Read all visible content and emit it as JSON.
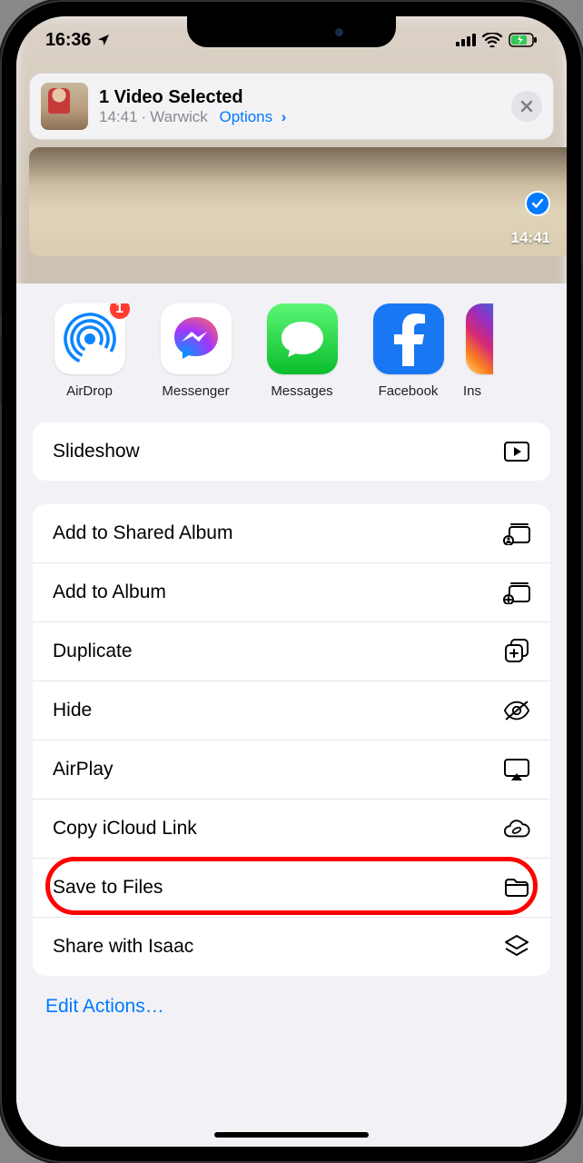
{
  "status": {
    "time": "16:36",
    "location_icon": "location-arrow"
  },
  "header": {
    "title": "1 Video Selected",
    "time": "14:41",
    "separator": "·",
    "location": "Warwick",
    "options_label": "Options"
  },
  "preview": {
    "timestamp": "14:41",
    "selected": true
  },
  "apps": [
    {
      "id": "airdrop",
      "label": "AirDrop",
      "badge": "1"
    },
    {
      "id": "messenger",
      "label": "Messenger"
    },
    {
      "id": "messages",
      "label": "Messages"
    },
    {
      "id": "facebook",
      "label": "Facebook"
    },
    {
      "id": "instagram",
      "label": "Ins"
    }
  ],
  "actions_group1": [
    {
      "id": "slideshow",
      "label": "Slideshow",
      "icon": "play-rect"
    }
  ],
  "actions_group2": [
    {
      "id": "add-shared-album",
      "label": "Add to Shared Album",
      "icon": "shared-album"
    },
    {
      "id": "add-album",
      "label": "Add to Album",
      "icon": "add-album"
    },
    {
      "id": "duplicate",
      "label": "Duplicate",
      "icon": "duplicate"
    },
    {
      "id": "hide",
      "label": "Hide",
      "icon": "eye-slash"
    },
    {
      "id": "airplay",
      "label": "AirPlay",
      "icon": "airplay"
    },
    {
      "id": "copy-icloud",
      "label": "Copy iCloud Link",
      "icon": "cloud-link"
    },
    {
      "id": "save-files",
      "label": "Save to Files",
      "icon": "folder",
      "highlighted": true
    },
    {
      "id": "share-isaac",
      "label": "Share with Isaac",
      "icon": "stack"
    }
  ],
  "edit_actions_label": "Edit Actions…"
}
